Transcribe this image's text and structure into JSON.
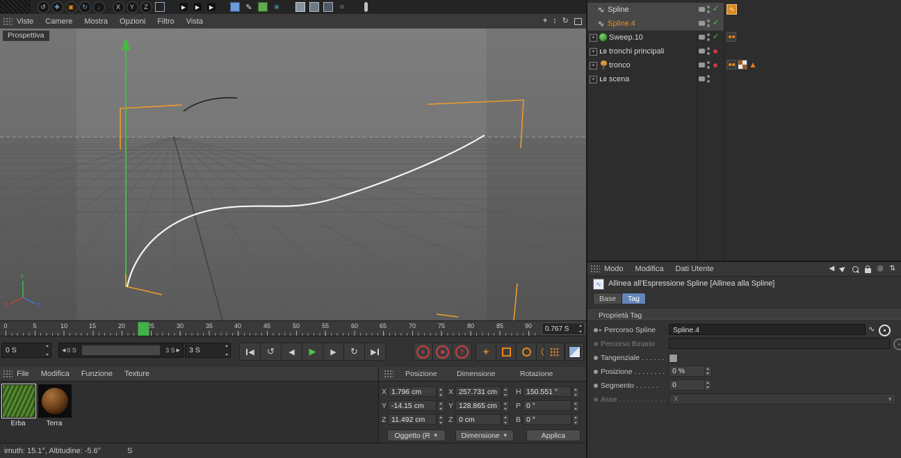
{
  "colors": {
    "accent_orange": "#e8871e",
    "selection_orange": "#f08c1e",
    "play_green": "#43b14b",
    "tab_blue": "#6286b8",
    "record_red": "#cf4040",
    "check_green": "#58c858"
  },
  "toolbar": {
    "icons": [
      "app-menu",
      "undo",
      "move-tool",
      "scale-tool",
      "rotate-tool",
      "last-used-tool",
      "lock-x-axis",
      "lock-y-axis",
      "lock-z-axis",
      "coordinate-system",
      "render-view",
      "render-region",
      "render-settings",
      "subdivision-surface",
      "pen-spline",
      "primitive-cube",
      "particles",
      "array-clone",
      "instance",
      "display-filter",
      "layout-pill"
    ]
  },
  "viewport": {
    "menu": [
      "Viste",
      "Camere",
      "Mostra",
      "Opzioni",
      "Filtro",
      "Vista"
    ],
    "view_label": "Prospettiva",
    "right_icons": [
      "pan-view-icon",
      "rotate-view-icon",
      "dolly-view-icon",
      "maximize-view-icon"
    ]
  },
  "timeline": {
    "ticks": [
      "0",
      "5",
      "10",
      "15",
      "20",
      "25",
      "30",
      "35",
      "40",
      "45",
      "50",
      "55",
      "60",
      "65",
      "70",
      "75",
      "80",
      "85",
      "90"
    ],
    "time_display": "0.767 S"
  },
  "transport": {
    "time_start": "0 S",
    "range_start": "0 S",
    "range_end": "3 S",
    "time_end": "3 S",
    "play_buttons": [
      "jump-start",
      "play-reverse",
      "prev-frame",
      "play-forward",
      "next-frame",
      "loop",
      "jump-end"
    ],
    "record_buttons": [
      "record-keyframe",
      "autokey",
      "keyframe-help"
    ],
    "key_buttons": [
      "position-key",
      "scale-key",
      "rotation-key",
      "parameter-key",
      "point-level-key"
    ]
  },
  "materials": {
    "menu": [
      "File",
      "Modifica",
      "Funzione",
      "Texture"
    ],
    "items": [
      {
        "name": "Erba"
      },
      {
        "name": "Terra"
      }
    ]
  },
  "coordinates": {
    "headers": [
      "Posizione",
      "Dimensione",
      "Rotazione"
    ],
    "position": {
      "labels": [
        "X",
        "Y",
        "Z"
      ],
      "values": [
        "1.796 cm",
        "-14.15 cm",
        "11.492 cm"
      ]
    },
    "dimension": {
      "labels": [
        "X",
        "Y",
        "Z"
      ],
      "values": [
        "257.731 cm",
        "128.865 cm",
        "0 cm"
      ]
    },
    "rotation": {
      "labels": [
        "H",
        "P",
        "B"
      ],
      "values": [
        "150.551 °",
        "0 °",
        "0 °"
      ]
    },
    "buttons": {
      "object": "Oggetto (R",
      "dimension": "Dimensione",
      "apply": "Applica"
    }
  },
  "object_manager": {
    "items": [
      {
        "name": "Spline"
      },
      {
        "name": "Spline.4"
      },
      {
        "name": "Sweep.10"
      },
      {
        "name": "tronchi principali"
      },
      {
        "name": "tronco"
      },
      {
        "name": "scena"
      }
    ]
  },
  "attributes": {
    "menu": [
      "Modo",
      "Modifica",
      "Dati Utente"
    ],
    "title": "Allinea all'Espressione Spline [Allinea alla Spline]",
    "tabs": [
      "Base",
      "Tag"
    ],
    "active_tab": "Tag",
    "section": "Proprietà Tag",
    "fields": {
      "spline_path": {
        "label": "Percorso Spline",
        "value": "Spline.4"
      },
      "rail_path": {
        "label": "Percorso Binario",
        "value": ""
      },
      "tangential": {
        "label": "Tangenziale . . . . . .",
        "checked": false
      },
      "position": {
        "label": "Posizione . . . . . . . .",
        "value": "0 %"
      },
      "segment": {
        "label": "Segmento . . . . . .",
        "value": "0"
      },
      "axis": {
        "label": "Asse . . . . . . . . . . . .",
        "value": "X"
      }
    }
  },
  "status_bar": {
    "text": "imuth: 15.1°, Altitudine: -5.6°",
    "suffix": "S"
  }
}
